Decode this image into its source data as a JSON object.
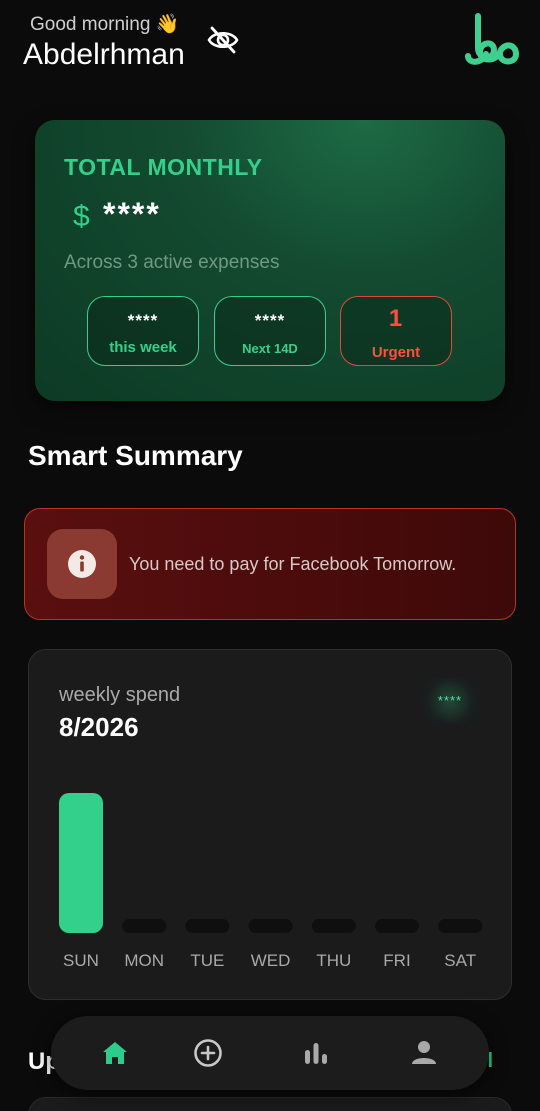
{
  "header": {
    "greeting": "Good morning 👋",
    "username": "Abdelrhman"
  },
  "icons": {
    "visibility": "eye-off-icon",
    "logo": "app-logo",
    "info": "info-icon",
    "home": "home-icon",
    "add": "add-circle-icon",
    "stats": "bar-chart-icon",
    "profile": "person-icon"
  },
  "total_card": {
    "title": "TOTAL MONTHLY",
    "currency": "$",
    "amount": "****",
    "subtitle": "Across 3 active expenses",
    "pills": [
      {
        "value": "****",
        "label": "this week"
      },
      {
        "value": "****",
        "label": "Next 14D"
      },
      {
        "value": "1",
        "label": "Urgent"
      }
    ]
  },
  "smart_summary": {
    "title": "Smart Summary",
    "alert_text": "You need to pay for Facebook Tomorrow."
  },
  "weekly": {
    "title": "weekly spend",
    "date": "8/2026",
    "total": "****"
  },
  "chart_data": {
    "type": "bar",
    "categories": [
      "SUN",
      "MON",
      "TUE",
      "WED",
      "THU",
      "FRI",
      "SAT"
    ],
    "values": [
      1,
      0,
      0,
      0,
      0,
      0,
      0
    ],
    "ylim": [
      0,
      1
    ],
    "grid": false,
    "legend": "none"
  },
  "upcoming": {
    "title": "Up",
    "link": "ll"
  },
  "colors": {
    "accent": "#33d08c",
    "urgent": "#ff4f3c",
    "background": "#0b0b0b",
    "card": "#1b1b1b",
    "empty_bar": "#0f0f0f"
  }
}
